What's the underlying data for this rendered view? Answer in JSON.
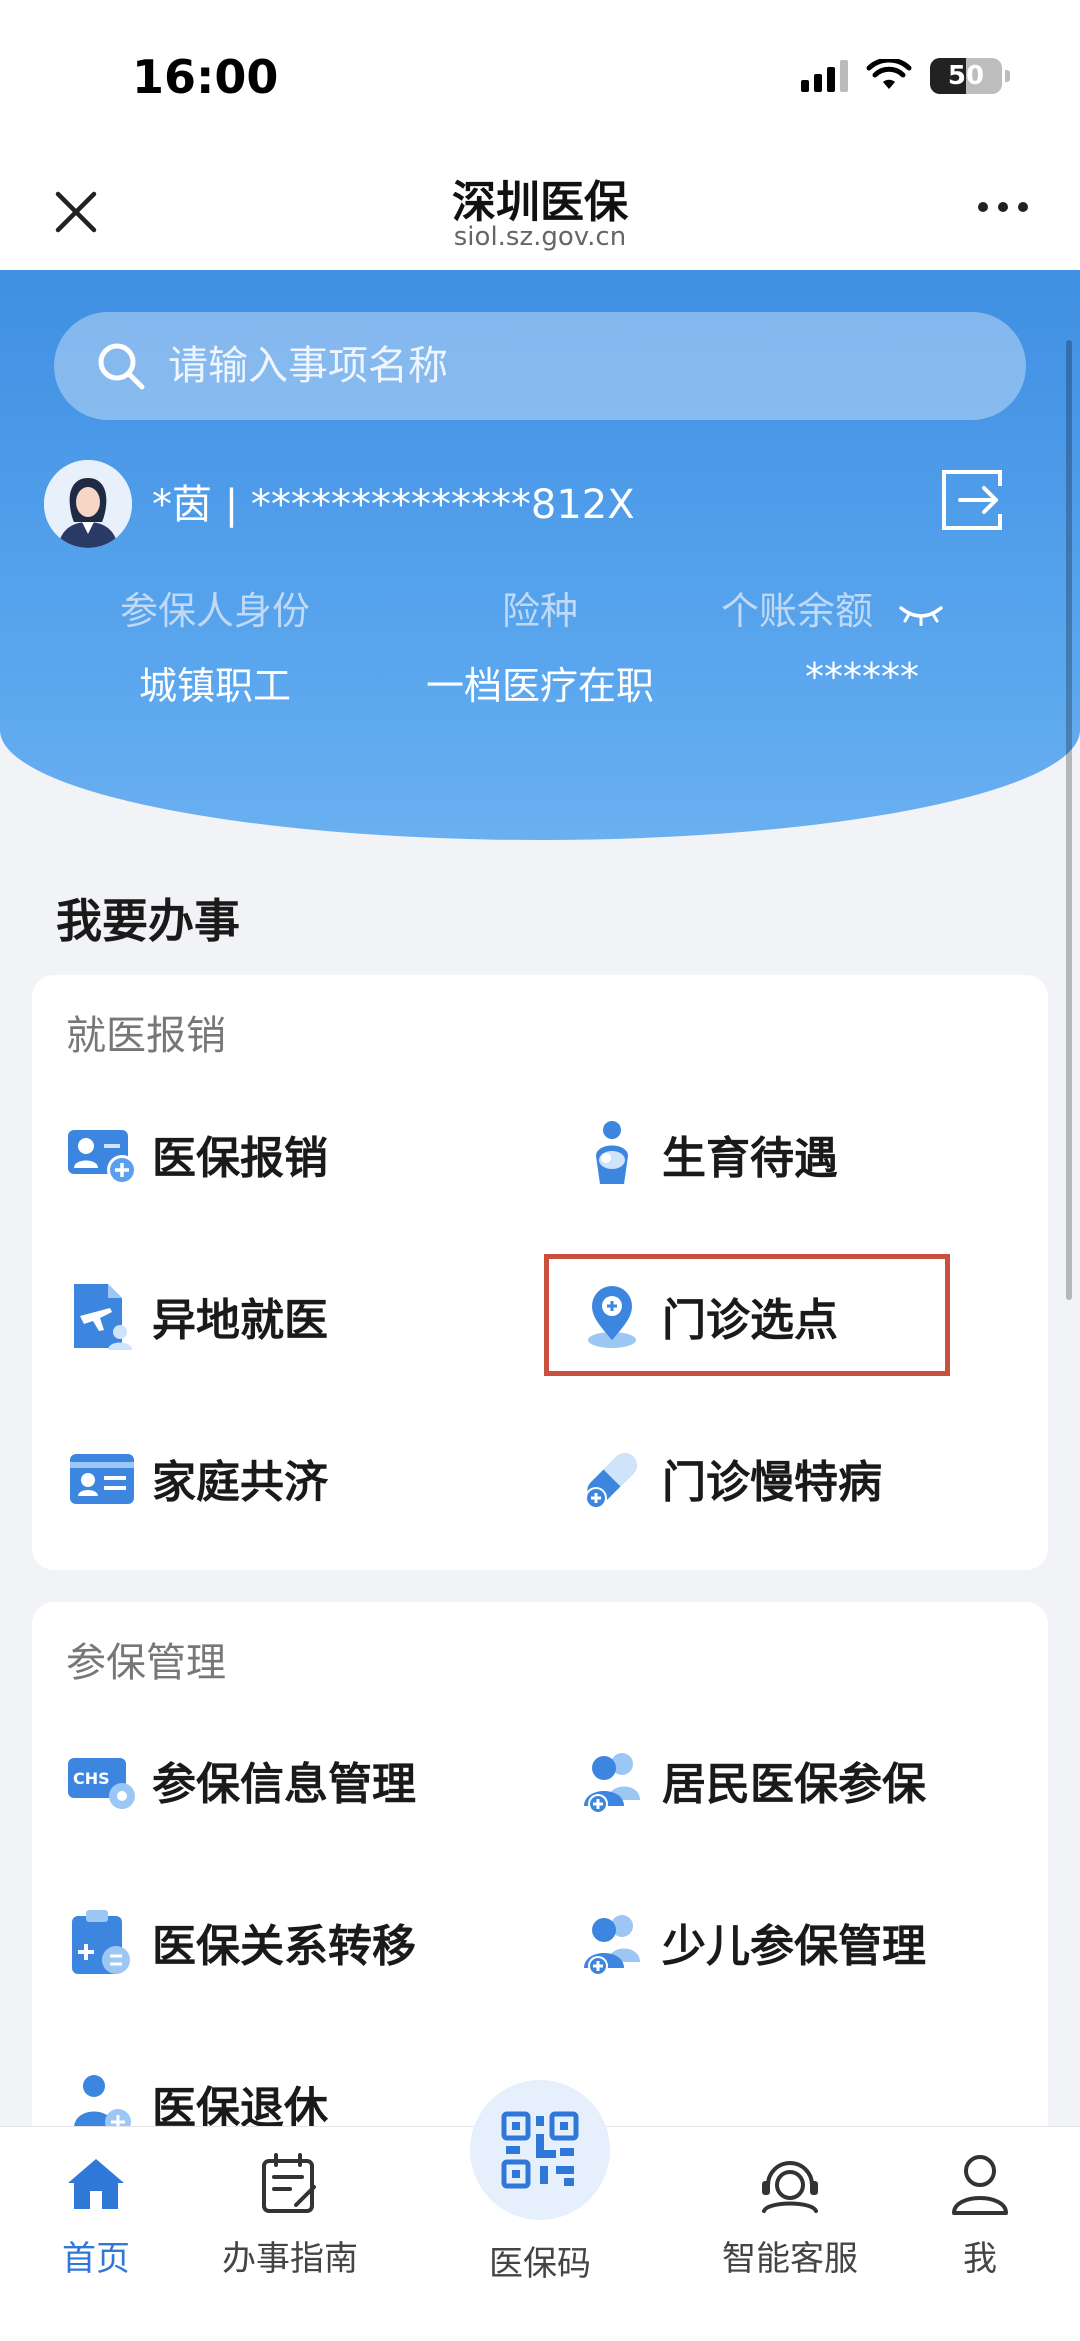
{
  "status_bar": {
    "time": "16:00",
    "battery": "50",
    "battery_level": 0.5
  },
  "nav": {
    "title": "深圳医保",
    "subtitle": "siol.sz.gov.cn"
  },
  "search": {
    "placeholder": "请输入事项名称"
  },
  "user": {
    "id_text": "*茵 | **************812X"
  },
  "info": {
    "labels": [
      "参保人身份",
      "险种",
      "个账余额"
    ],
    "values": [
      "城镇职工",
      "一档医疗在职",
      "******"
    ]
  },
  "section": {
    "title": "我要办事"
  },
  "cards": [
    {
      "title": "就医报销",
      "items": [
        {
          "label": "医保报销",
          "icon": "reimburse-icon"
        },
        {
          "label": "生育待遇",
          "icon": "maternity-icon"
        },
        {
          "label": "异地就医",
          "icon": "remote-medical-icon"
        },
        {
          "label": "门诊选点",
          "icon": "clinic-location-icon"
        },
        {
          "label": "家庭共济",
          "icon": "family-icon"
        },
        {
          "label": "门诊慢特病",
          "icon": "medicine-pill-icon"
        }
      ]
    },
    {
      "title": "参保管理",
      "items": [
        {
          "label": "参保信息管理",
          "icon": "chs-gear-icon"
        },
        {
          "label": "居民医保参保",
          "icon": "resident-insure-icon"
        },
        {
          "label": "医保关系转移",
          "icon": "transfer-icon"
        },
        {
          "label": "少儿参保管理",
          "icon": "child-insure-icon"
        },
        {
          "label": "医保退休",
          "icon": "retire-icon"
        }
      ]
    }
  ],
  "tabs": [
    {
      "label": "首页",
      "icon": "home-icon"
    },
    {
      "label": "办事指南",
      "icon": "guide-icon"
    },
    {
      "label": "医保码",
      "icon": "qr-code-icon"
    },
    {
      "label": "智能客服",
      "icon": "headset-icon"
    },
    {
      "label": "我",
      "icon": "person-icon"
    }
  ],
  "colors": {
    "accent": "#2f78d8",
    "header": "#4a9be8",
    "highlight": "#c9503f"
  }
}
